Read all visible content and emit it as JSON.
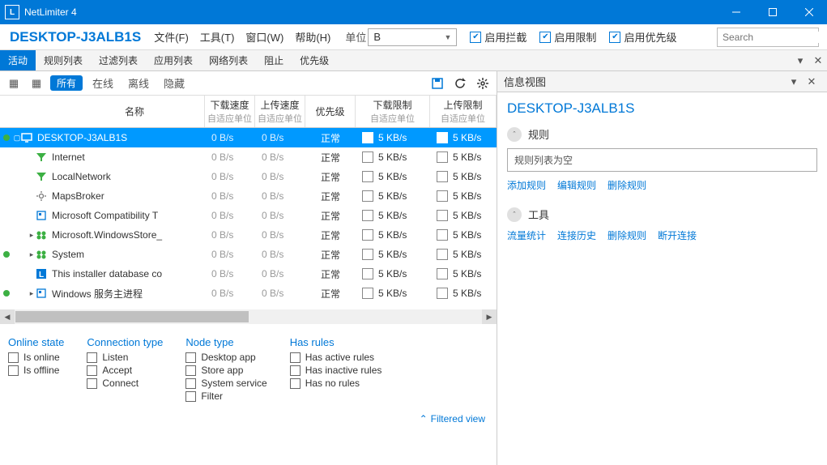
{
  "window": {
    "title": "NetLimiter 4"
  },
  "brand": "DESKTOP-J3ALB1S",
  "menu": {
    "file": "文件(F)",
    "tools": "工具(T)",
    "window": "窗口(W)",
    "help": "帮助(H)"
  },
  "unit_label": "单位",
  "unit_value": "B",
  "checks": {
    "block": "启用拦截",
    "limit": "启用限制",
    "priority": "启用优先级"
  },
  "search_placeholder": "Search",
  "tabs": [
    "活动",
    "规则列表",
    "过滤列表",
    "应用列表",
    "网络列表",
    "阻止",
    "优先级"
  ],
  "info_view_title": "信息视图",
  "toolbar_filters": {
    "all": "所有",
    "online": "在线",
    "offline": "离线",
    "hidden": "隐藏"
  },
  "columns": {
    "name": "名称",
    "down_speed": "下载速度",
    "up_speed": "上传速度",
    "auto_unit": "自适应单位",
    "priority": "优先级",
    "down_limit": "下载限制",
    "up_limit": "上传限制"
  },
  "rows": [
    {
      "dot": true,
      "exp": "▢",
      "indent": 0,
      "icon": "monitor",
      "iconColor": "#fff",
      "name": "DESKTOP-J3ALB1S",
      "d": "0 B/s",
      "u": "0 B/s",
      "p": "正常",
      "dl": "5 KB/s",
      "ul": "5 KB/s",
      "sel": true
    },
    {
      "dot": false,
      "exp": "",
      "indent": 1,
      "icon": "filter",
      "iconColor": "#3cb043",
      "name": "Internet",
      "d": "0 B/s",
      "u": "0 B/s",
      "p": "正常",
      "dl": "5 KB/s",
      "ul": "5 KB/s"
    },
    {
      "dot": false,
      "exp": "",
      "indent": 1,
      "icon": "filter",
      "iconColor": "#3cb043",
      "name": "LocalNetwork",
      "d": "0 B/s",
      "u": "0 B/s",
      "p": "正常",
      "dl": "5 KB/s",
      "ul": "5 KB/s"
    },
    {
      "dot": false,
      "exp": "",
      "indent": 1,
      "icon": "gear",
      "iconColor": "#777",
      "name": "MapsBroker",
      "d": "0 B/s",
      "u": "0 B/s",
      "p": "正常",
      "dl": "5 KB/s",
      "ul": "5 KB/s"
    },
    {
      "dot": false,
      "exp": "",
      "indent": 1,
      "icon": "app",
      "iconColor": "#0078d7",
      "name": "Microsoft Compatibility T",
      "d": "0 B/s",
      "u": "0 B/s",
      "p": "正常",
      "dl": "5 KB/s",
      "ul": "5 KB/s"
    },
    {
      "dot": false,
      "exp": "▸",
      "indent": 1,
      "icon": "store",
      "iconColor": "#3cb043",
      "name": "Microsoft.WindowsStore_",
      "d": "0 B/s",
      "u": "0 B/s",
      "p": "正常",
      "dl": "5 KB/s",
      "ul": "5 KB/s"
    },
    {
      "dot": true,
      "exp": "▸",
      "indent": 1,
      "icon": "store",
      "iconColor": "#3cb043",
      "name": "System",
      "d": "0 B/s",
      "u": "0 B/s",
      "p": "正常",
      "dl": "5 KB/s",
      "ul": "5 KB/s"
    },
    {
      "dot": false,
      "exp": "",
      "indent": 1,
      "icon": "nl",
      "iconColor": "#0078d7",
      "name": "This installer database co",
      "d": "0 B/s",
      "u": "0 B/s",
      "p": "正常",
      "dl": "5 KB/s",
      "ul": "5 KB/s"
    },
    {
      "dot": true,
      "exp": "▸",
      "indent": 1,
      "icon": "app",
      "iconColor": "#0078d7",
      "name": "Windows 服务主进程",
      "d": "0 B/s",
      "u": "0 B/s",
      "p": "正常",
      "dl": "5 KB/s",
      "ul": "5 KB/s"
    }
  ],
  "filter_panel": {
    "online_state": {
      "title": "Online state",
      "items": [
        "Is online",
        "Is offline"
      ]
    },
    "connection_type": {
      "title": "Connection type",
      "items": [
        "Listen",
        "Accept",
        "Connect"
      ]
    },
    "node_type": {
      "title": "Node type",
      "items": [
        "Desktop app",
        "Store app",
        "System service",
        "Filter"
      ]
    },
    "has_rules": {
      "title": "Has rules",
      "items": [
        "Has active rules",
        "Has inactive rules",
        "Has no rules"
      ]
    }
  },
  "filtered_view": "Filtered view",
  "right_panel": {
    "title": "DESKTOP-J3ALB1S",
    "section_rules": "规则",
    "rules_empty": "规则列表为空",
    "rule_links": [
      "添加规则",
      "编辑规则",
      "删除规则"
    ],
    "section_tools": "工具",
    "tool_links": [
      "流量统计",
      "连接历史",
      "删除规则",
      "断开连接"
    ]
  }
}
